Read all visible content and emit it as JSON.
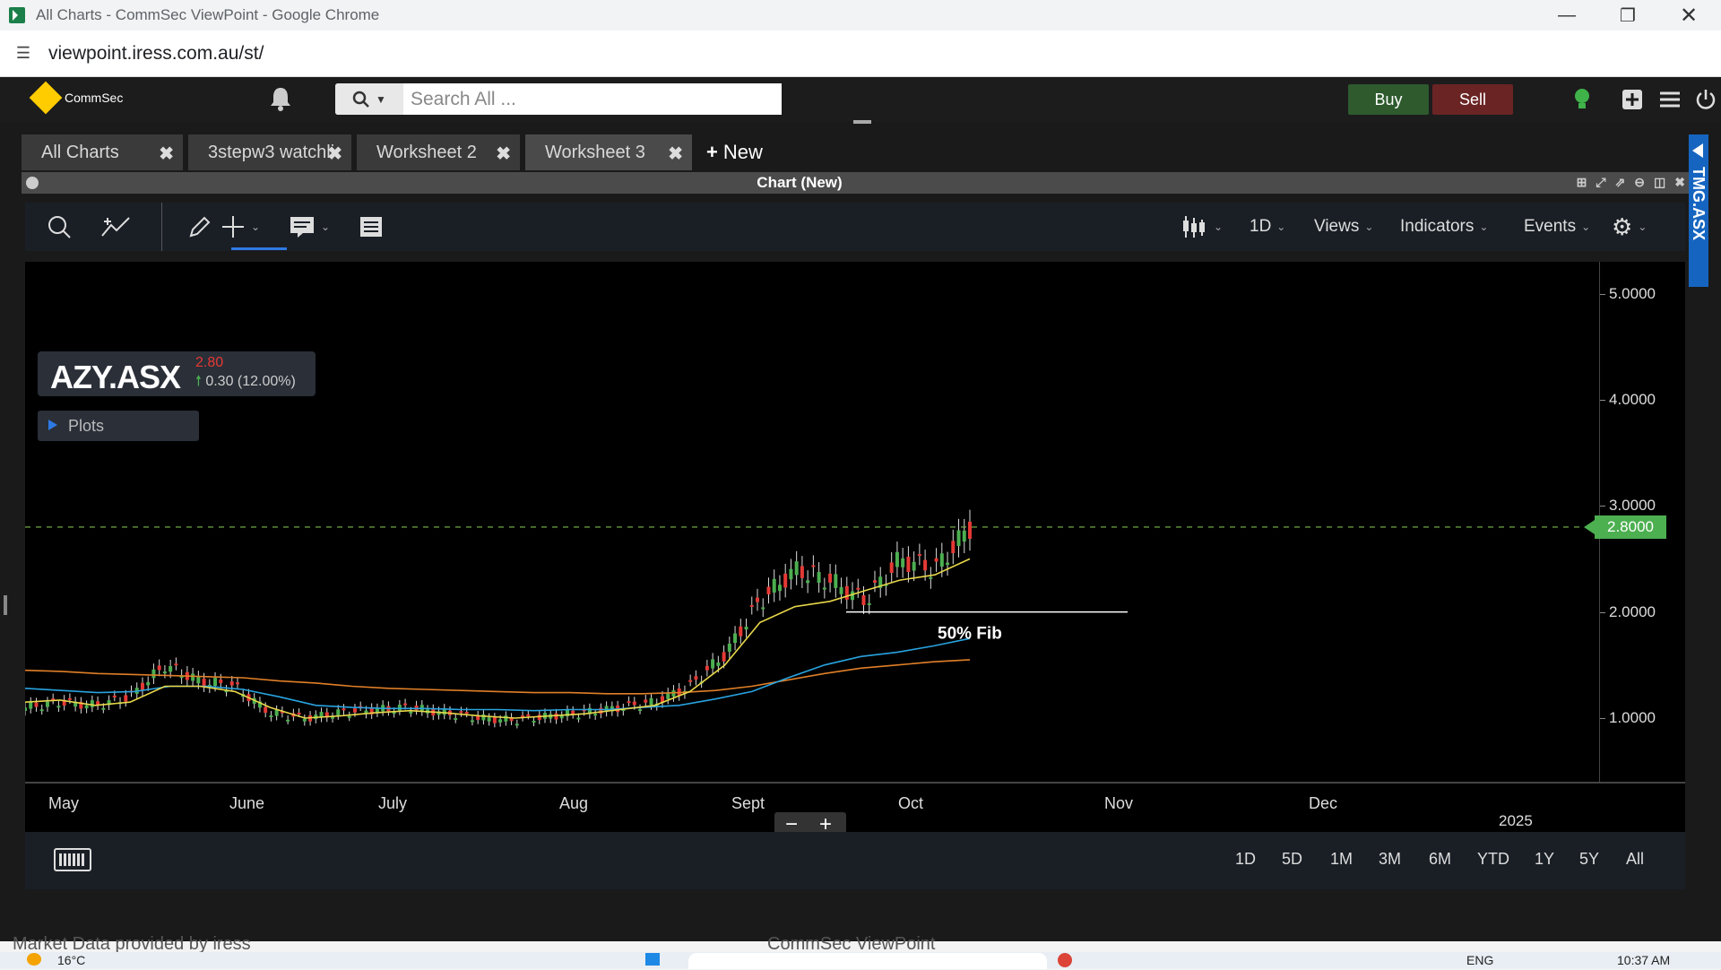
{
  "window": {
    "title": "All Charts - CommSec ViewPoint - Google Chrome",
    "url": "viewpoint.iress.com.au/st/"
  },
  "topnav": {
    "brand": "CommSec",
    "search_placeholder": "Search All ...",
    "buy_label": "Buy",
    "sell_label": "Sell"
  },
  "tabs": [
    {
      "label": "All Charts"
    },
    {
      "label": "3stepw3 watchli"
    },
    {
      "label": "Worksheet 2"
    },
    {
      "label": "Worksheet 3"
    }
  ],
  "new_tab_label": "New",
  "panel": {
    "title": "Chart (New)",
    "side_tab": "TMG.ASX"
  },
  "toolbar": {
    "interval": "1D",
    "views": "Views",
    "indicators": "Indicators",
    "events": "Events"
  },
  "symbol": {
    "code": "AZY.ASX",
    "last": "2.80",
    "change": "0.30 (12.00%)"
  },
  "plots_label": "Plots",
  "annotation": "50% Fib",
  "current_price_label": "2.8000",
  "colors": {
    "up": "#4caf50",
    "down": "#e53935",
    "ma_fast": "#e8d84a",
    "ma_mid": "#29a3e0",
    "ma_slow": "#e07f28",
    "accent": "#2e7ae5"
  },
  "chart_data": {
    "type": "line",
    "y_ticks": [
      "5.0000",
      "4.0000",
      "3.0000",
      "2.0000",
      "1.0000"
    ],
    "ylim": [
      0.4,
      5.3
    ],
    "x_ticks": [
      "May",
      "June",
      "July",
      "Aug",
      "Sept",
      "Oct",
      "Nov",
      "Dec"
    ],
    "x_tick_year": "2025",
    "current_price": 2.8,
    "fib_level": 2.0,
    "series": [
      {
        "key": "price",
        "values": [
          1.1,
          1.15,
          1.12,
          1.2,
          1.5,
          1.35,
          1.3,
          1.05,
          1.0,
          1.05,
          1.08,
          1.1,
          1.05,
          1.0,
          0.98,
          1.02,
          1.05,
          1.1,
          1.15,
          1.3,
          1.6,
          2.1,
          2.4,
          2.3,
          2.1,
          2.5,
          2.4,
          2.8
        ]
      },
      {
        "key": "ma_fast",
        "values": [
          1.15,
          1.17,
          1.12,
          1.15,
          1.3,
          1.3,
          1.25,
          1.1,
          1.0,
          1.02,
          1.05,
          1.07,
          1.05,
          1.02,
          1.0,
          1.02,
          1.04,
          1.08,
          1.12,
          1.25,
          1.5,
          1.9,
          2.05,
          2.1,
          2.2,
          2.3,
          2.35,
          2.5
        ]
      },
      {
        "key": "ma_mid",
        "values": [
          1.28,
          1.26,
          1.24,
          1.25,
          1.3,
          1.3,
          1.27,
          1.2,
          1.12,
          1.1,
          1.09,
          1.09,
          1.08,
          1.08,
          1.07,
          1.08,
          1.08,
          1.1,
          1.12,
          1.18,
          1.25,
          1.38,
          1.5,
          1.58,
          1.62,
          1.68,
          1.75
        ]
      },
      {
        "key": "ma_slow",
        "values": [
          1.45,
          1.44,
          1.42,
          1.41,
          1.4,
          1.39,
          1.38,
          1.35,
          1.33,
          1.3,
          1.28,
          1.27,
          1.26,
          1.25,
          1.24,
          1.24,
          1.23,
          1.23,
          1.24,
          1.26,
          1.3,
          1.36,
          1.42,
          1.47,
          1.5,
          1.53,
          1.55
        ]
      }
    ]
  },
  "ranges": [
    "1D",
    "5D",
    "1M",
    "3M",
    "6M",
    "YTD",
    "1Y",
    "5Y",
    "All"
  ],
  "status": {
    "market_data": "Market Data provided by  iress",
    "bottom_center": "CommSec ViewPoint"
  },
  "taskbar": {
    "weather": "16°C",
    "lang": "ENG",
    "time": "10:37 AM"
  }
}
